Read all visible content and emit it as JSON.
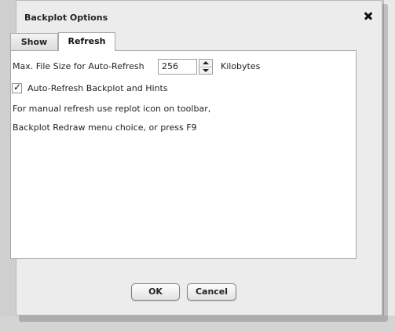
{
  "dialog": {
    "title": "Backplot Options",
    "close_icon": "close-icon"
  },
  "tabs": [
    {
      "label": "Show",
      "selected": false
    },
    {
      "label": "Refresh",
      "selected": true
    }
  ],
  "refresh": {
    "max_size_label": "Max. File Size for Auto-Refresh",
    "max_size_value": "256",
    "max_size_unit": "Kilobytes",
    "auto_refresh_label": "Auto-Refresh Backplot and Hints",
    "auto_refresh_checked": true,
    "checkmark_glyph": "✓",
    "info_line1": "For manual refresh use replot icon on toolbar,",
    "info_line2": "Backplot Redraw menu choice, or press F9"
  },
  "buttons": {
    "ok": "OK",
    "cancel": "Cancel"
  }
}
